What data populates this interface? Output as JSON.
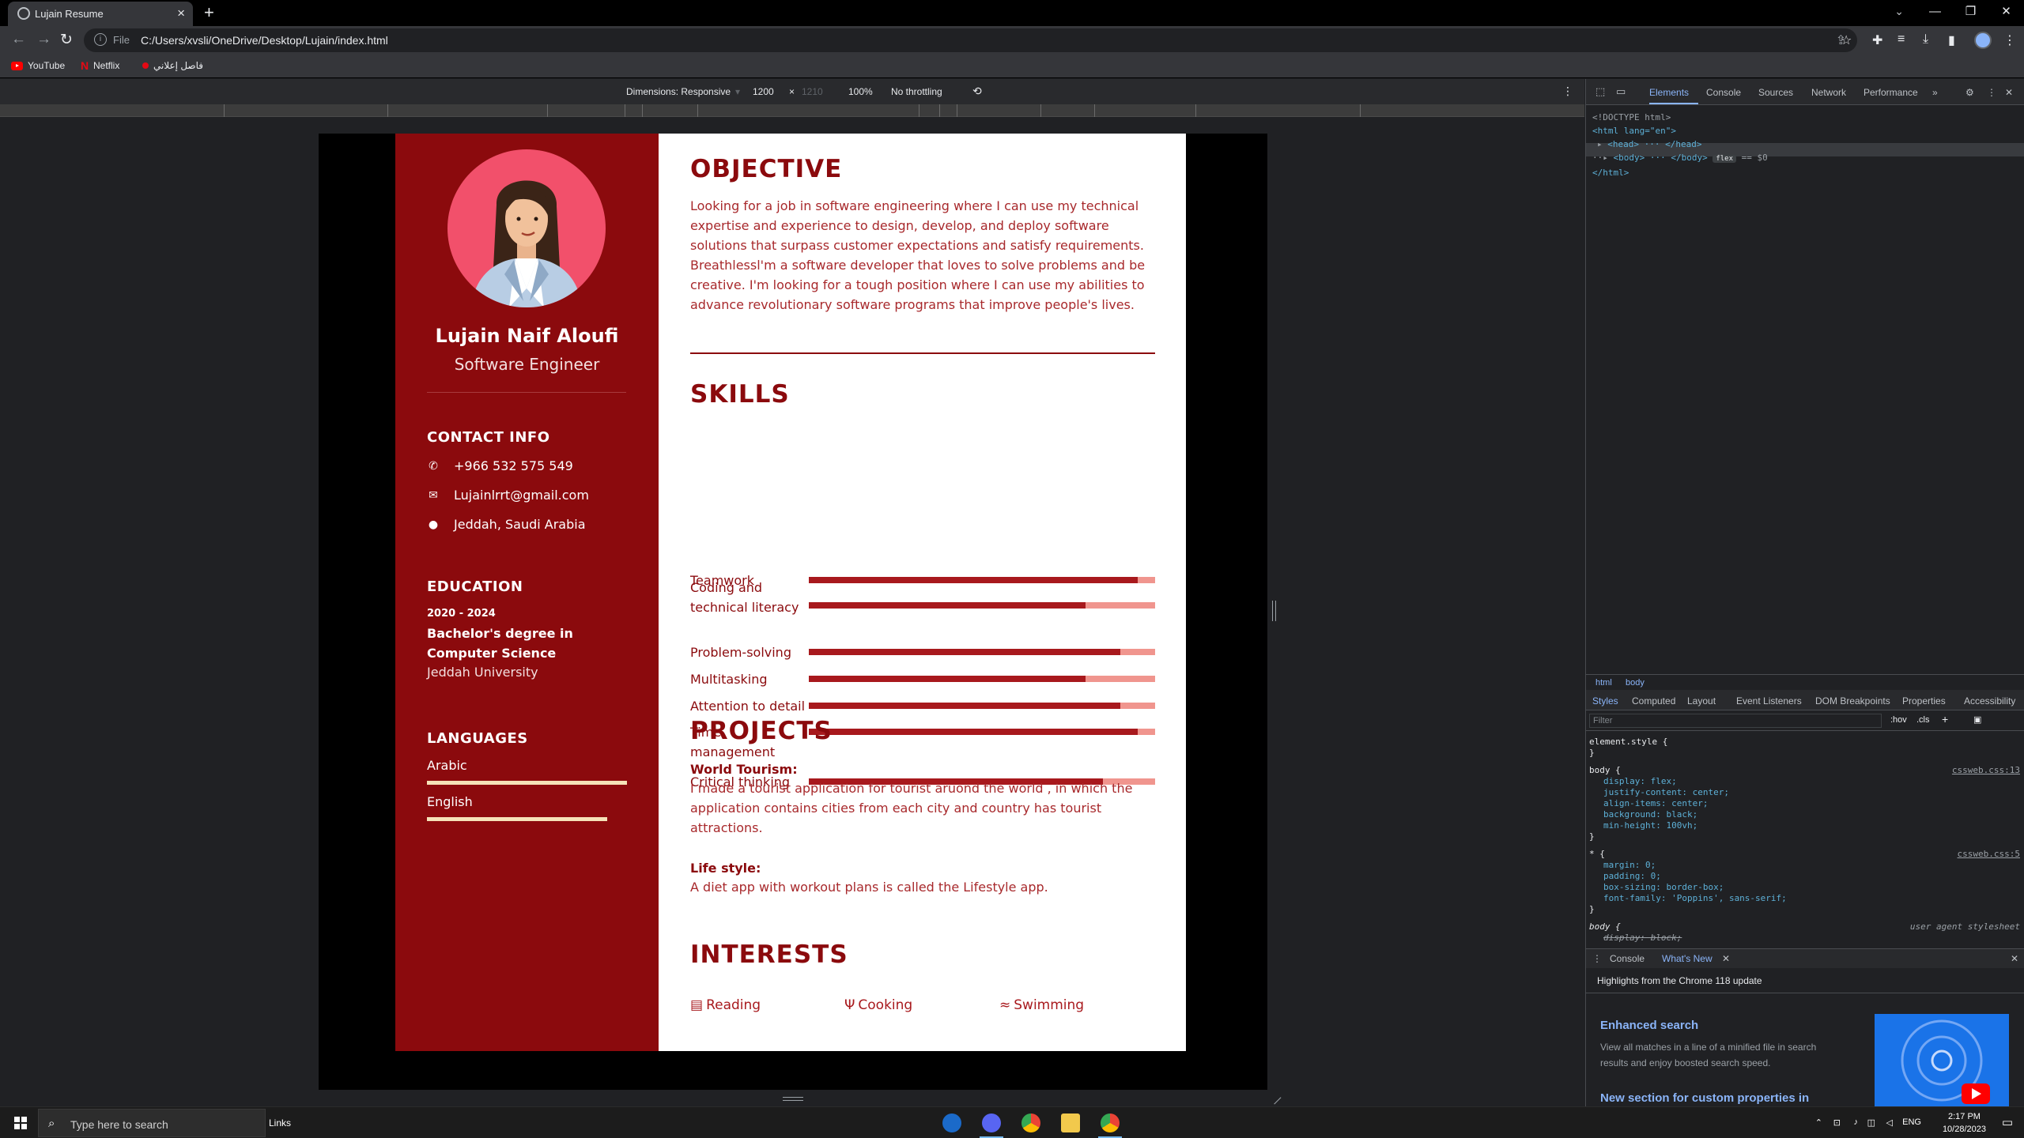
{
  "browser": {
    "tab_title": "Lujain Resume",
    "file_label": "File",
    "url": "C:/Users/xvsli/OneDrive/Desktop/Lujain/index.html",
    "bookmarks": [
      "YouTube",
      "Netflix",
      "فاصل إعلاني"
    ]
  },
  "device_toolbar": {
    "dimensions": "Dimensions: Responsive",
    "width": "1200",
    "times": "×",
    "height": "1210",
    "zoom": "100%",
    "throttle": "No throttling"
  },
  "resume": {
    "name": "Lujain Naif Aloufi",
    "role": "Software Engineer",
    "contact_heading": "CONTACT INFO",
    "phone": "+966 532 575 549",
    "email": "Lujainlrrt@gmail.com",
    "location": "Jeddah, Saudi Arabia",
    "education_heading": "EDUCATION",
    "edu_years": "2020 - 2024",
    "edu_degree": "Bachelor's degree in Computer Science",
    "edu_school": "Jeddah University",
    "languages_heading": "LANGUAGES",
    "languages": [
      {
        "name": "Arabic",
        "level": 1.0
      },
      {
        "name": "English",
        "level": 0.9
      }
    ],
    "objective_heading": "OBJECTIVE",
    "objective_text": "Looking for a job in software engineering where I can use my technical expertise and experience to design, develop, and deploy software solutions that surpass customer expectations and satisfy requirements. Breathlessl'm a software developer that loves to solve problems and be creative. I'm looking for a tough position where I can use my abilities to advance revolutionary software programs that improve people's lives.",
    "skills_heading": "SKILLS",
    "skills": [
      {
        "label": "Teamwork",
        "level": 0.95
      },
      {
        "label": "Coding and technical literacy",
        "level": 0.8
      },
      {
        "label": "Problem-solving",
        "level": 0.9
      },
      {
        "label": "Multitasking",
        "level": 0.8
      },
      {
        "label": "Attention to detail",
        "level": 0.9
      },
      {
        "label": "Time management",
        "level": 0.95
      },
      {
        "label": "Critical thinking",
        "level": 0.85
      }
    ],
    "projects_heading": "PROJECTS",
    "projects": [
      {
        "title": "World Tourism:",
        "text": "I made a tourist application for tourist aruond the world , in which the application contains cities from each city and country has tourist attractions."
      },
      {
        "title": "Life style:",
        "text": "A diet app with workout plans is called the Lifestyle app."
      }
    ],
    "interests_heading": "INTERESTS",
    "interests": [
      "Reading",
      "Cooking",
      "Swimming"
    ]
  },
  "devtools": {
    "tabs": [
      "Elements",
      "Console",
      "Sources",
      "Network",
      "Performance"
    ],
    "dom": {
      "doctype": "<!DOCTYPE html>",
      "html_open": "<html lang=\"en\">",
      "head": "<head> ··· </head>",
      "body": "<body> ··· </body>",
      "flex_badge": "flex",
      "dollar": "== $0",
      "html_close": "</html>"
    },
    "crumbs": [
      "html",
      "body"
    ],
    "style_tabs": [
      "Styles",
      "Computed",
      "Layout",
      "Event Listeners",
      "DOM Breakpoints",
      "Properties",
      "Accessibility"
    ],
    "filter_placeholder": "Filter",
    "hov": ":hov",
    "cls": ".cls",
    "element_style": "element.style {",
    "body_rule_src": "cssweb.css:13",
    "body_props": [
      "display: flex;",
      "justify-content: center;",
      "align-items: center;",
      "background: black;",
      "min-height: 100vh;"
    ],
    "star_rule_src": "cssweb.css:5",
    "star_props": [
      "margin: 0;",
      "padding: 0;",
      "box-sizing: border-box;",
      "font-family: 'Poppins', sans-serif;"
    ],
    "ua_label": "user agent stylesheet",
    "ua_prop": "display: block;",
    "drawer_tabs": [
      "Console",
      "What's New"
    ],
    "wn_head": "Highlights from the Chrome 118 update",
    "wn_search": "Enhanced search",
    "wn_desc": "View all matches in a line of a minified file in search results and enjoy boosted search speed.",
    "wn_custom": "New section for custom properties in"
  },
  "taskbar": {
    "search_placeholder": "Type here to search",
    "links": "Links",
    "lang": "ENG",
    "time": "2:17 PM",
    "date": "10/28/2023"
  },
  "colors": {
    "sidebar": "#8b0a0d",
    "accent": "#a8191d",
    "skill_track": "#f0958e",
    "photo_bg": "#f2506b"
  }
}
